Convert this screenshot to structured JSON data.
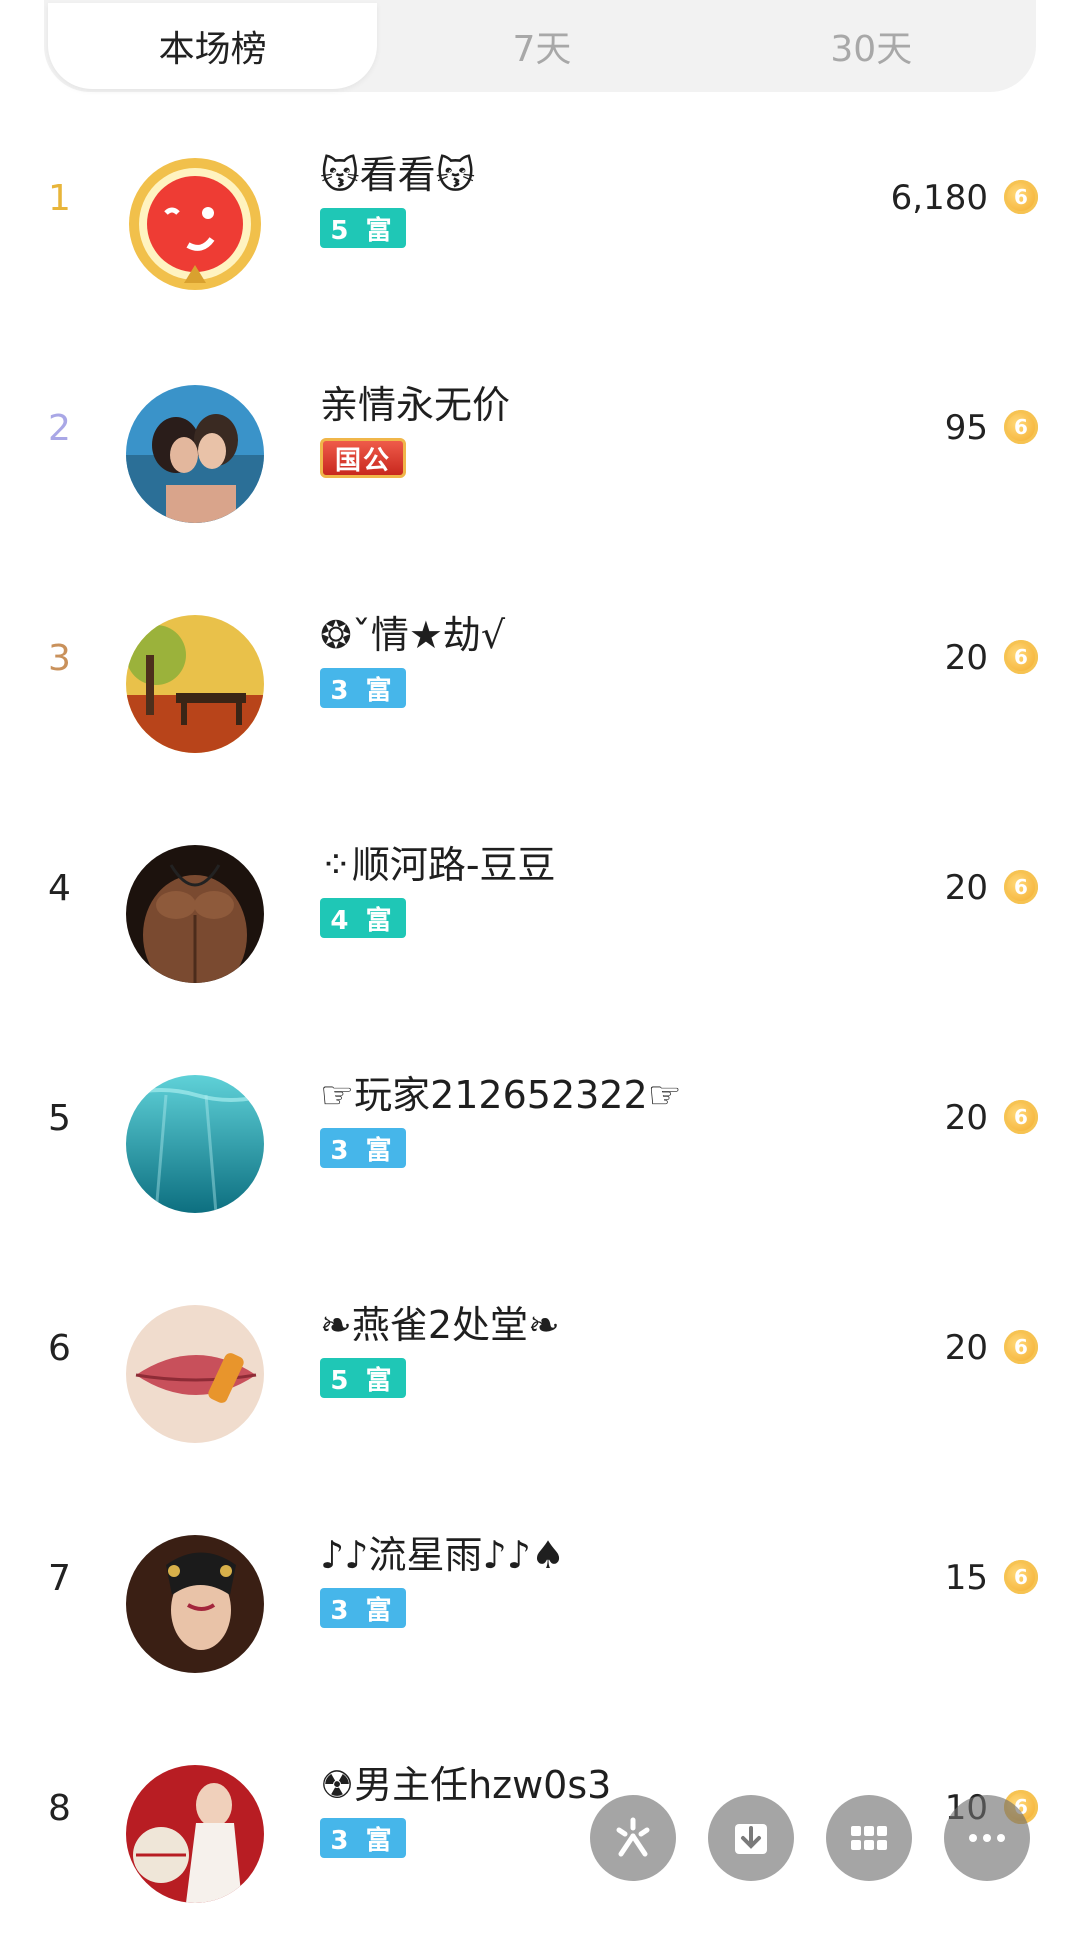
{
  "tabs": [
    {
      "label": "本场榜",
      "active": true
    },
    {
      "label": "7天",
      "active": false
    },
    {
      "label": "30天",
      "active": false
    }
  ],
  "rows": [
    {
      "rank": "1",
      "rank_color": "#e8b53a",
      "name": "😽看看😽",
      "badge": "5 富",
      "badge_color": "#1fc7b6",
      "score": "6,180"
    },
    {
      "rank": "2",
      "rank_color": "#a9a7e6",
      "name": "亲情永无价",
      "badge": "国公",
      "badge_color": "#d83a2c",
      "score": "95"
    },
    {
      "rank": "3",
      "rank_color": "#c9915b",
      "name": "❂ˇ情★劫√",
      "badge": "3 富",
      "badge_color": "#46b6ea",
      "score": "20"
    },
    {
      "rank": "4",
      "rank_color": "#222222",
      "name": "⁘顺河路-豆豆",
      "badge": "4 富",
      "badge_color": "#1fc7b6",
      "score": "20"
    },
    {
      "rank": "5",
      "rank_color": "#222222",
      "name": "☞玩家212652322☞",
      "badge": "3 富",
      "badge_color": "#46b6ea",
      "score": "20"
    },
    {
      "rank": "6",
      "rank_color": "#222222",
      "name": "❧燕雀2处堂❧",
      "badge": "5 富",
      "badge_color": "#1fc7b6",
      "score": "20"
    },
    {
      "rank": "7",
      "rank_color": "#222222",
      "name": "♪♪流星雨♪♪♠",
      "badge": "3 富",
      "badge_color": "#46b6ea",
      "score": "15"
    },
    {
      "rank": "8",
      "rank_color": "#222222",
      "name": "☢男主任hzw0s3",
      "badge": "3 富",
      "badge_color": "#46b6ea",
      "score": "10"
    }
  ],
  "coin_symbol": "6",
  "fab_buttons": [
    {
      "name": "sparkle-icon"
    },
    {
      "name": "download-icon"
    },
    {
      "name": "grid-icon"
    },
    {
      "name": "more-icon"
    }
  ]
}
